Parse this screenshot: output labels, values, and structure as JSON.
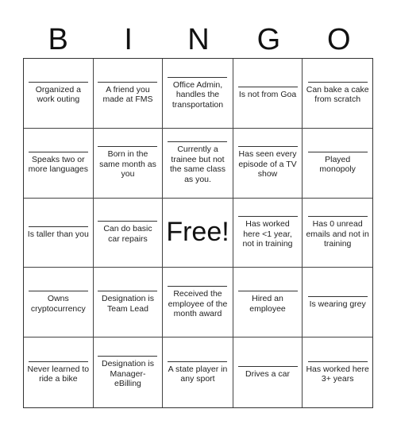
{
  "header": {
    "letters": [
      "B",
      "I",
      "N",
      "G",
      "O"
    ]
  },
  "cells": [
    "Organized a work outing",
    "A friend you made at FMS",
    "Office Admin, handles the transportation",
    "Is not from Goa",
    "Can bake a cake from scratch",
    "Speaks two or more languages",
    "Born in the same month as you",
    "Currently a trainee but not the same class as you.",
    "Has seen every episode of a TV show",
    "Played monopoly",
    "Is taller than you",
    "Can do basic car repairs",
    "Free!",
    "Has worked here <1 year, not in training",
    "Has 0 unread emails and not in training",
    "Owns cryptocurrency",
    "Designation is Team Lead",
    "Received the employee of the month award",
    "Hired an employee",
    "Is wearing grey",
    "Never learned to ride a bike",
    "Designation is Manager-eBilling",
    "A state player in any sport",
    "Drives a car",
    "Has worked here 3+ years"
  ],
  "free_index": 12
}
